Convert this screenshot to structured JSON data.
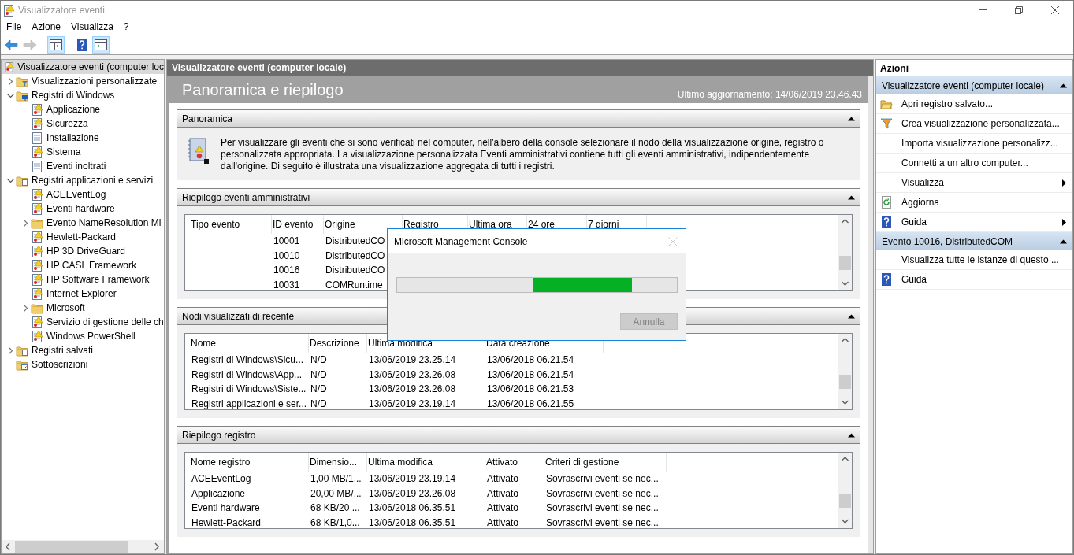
{
  "window": {
    "title": "Visualizzatore eventi"
  },
  "menu": [
    "File",
    "Azione",
    "Visualizza",
    "?"
  ],
  "toolbar": [
    {
      "buttons": [
        {
          "kind": "back",
          "disabled": false,
          "pressed": false
        },
        {
          "kind": "forward",
          "disabled": true,
          "pressed": false
        }
      ]
    },
    {
      "buttons": [
        {
          "kind": "tree-pane",
          "disabled": false,
          "pressed": true
        }
      ]
    },
    {
      "buttons": [
        {
          "kind": "help",
          "disabled": false,
          "pressed": false
        },
        {
          "kind": "action-pane",
          "disabled": false,
          "pressed": true
        }
      ]
    }
  ],
  "tree": [
    {
      "label": "Visualizzatore eventi (computer loc",
      "kind": "viewer",
      "selected": true,
      "children": [
        {
          "label": "Visualizzazioni personalizzate",
          "kind": "filter-folder",
          "selected": false,
          "expandable": true,
          "expanded": false
        },
        {
          "label": "Registri di Windows",
          "kind": "windows-folder",
          "selected": false,
          "expandable": true,
          "expanded": true,
          "children": [
            {
              "label": "Applicazione",
              "kind": "log",
              "selected": false,
              "expandable": false
            },
            {
              "label": "Sicurezza",
              "kind": "log",
              "selected": false,
              "expandable": false
            },
            {
              "label": "Installazione",
              "kind": "plain-log",
              "selected": false,
              "expandable": false
            },
            {
              "label": "Sistema",
              "kind": "log",
              "selected": false,
              "expandable": false
            },
            {
              "label": "Eventi inoltrati",
              "kind": "plain-log",
              "selected": false,
              "expandable": false
            }
          ]
        },
        {
          "label": "Registri applicazioni e servizi",
          "kind": "folder-doc",
          "selected": false,
          "expandable": true,
          "expanded": true,
          "children": [
            {
              "label": "ACEEventLog",
              "kind": "log",
              "selected": false,
              "expandable": false
            },
            {
              "label": "Eventi hardware",
              "kind": "log",
              "selected": false,
              "expandable": false
            },
            {
              "label": "Evento NameResolution Mi",
              "kind": "folder",
              "selected": false,
              "expandable": true,
              "expanded": false
            },
            {
              "label": "Hewlett-Packard",
              "kind": "log",
              "selected": false,
              "expandable": false
            },
            {
              "label": "HP 3D DriveGuard",
              "kind": "log",
              "selected": false,
              "expandable": false
            },
            {
              "label": "HP CASL Framework",
              "kind": "log",
              "selected": false,
              "expandable": false
            },
            {
              "label": "HP Software Framework",
              "kind": "log",
              "selected": false,
              "expandable": false
            },
            {
              "label": "Internet Explorer",
              "kind": "log",
              "selected": false,
              "expandable": false
            },
            {
              "label": "Microsoft",
              "kind": "folder",
              "selected": false,
              "expandable": true,
              "expanded": false
            },
            {
              "label": "Servizio di gestione delle ch",
              "kind": "log",
              "selected": false,
              "expandable": false
            },
            {
              "label": "Windows PowerShell",
              "kind": "log",
              "selected": false,
              "expandable": false
            }
          ]
        },
        {
          "label": "Registri salvati",
          "kind": "folder-doc",
          "selected": false,
          "expandable": true,
          "expanded": false
        },
        {
          "label": "Sottoscrizioni",
          "kind": "subscriptions",
          "selected": false,
          "expandable": false
        }
      ]
    }
  ],
  "center": {
    "header": "Visualizzatore eventi (computer locale)",
    "title": "Panoramica e riepilogo",
    "last_update": "Ultimo aggiornamento: 14/06/2019 23.46.43",
    "sections": [
      {
        "kind": "text",
        "title": "Panoramica",
        "expanded": true,
        "text": "Per visualizzare gli eventi che si sono verificati nel computer, nell'albero della console selezionare il nodo della visualizzazione origine, registro o personalizzata appropriata. La visualizzazione personalizzata Eventi amministrativi contiene tutti gli eventi amministrativi, indipendentemente dall'origine. Di seguito è illustrata una visualizzazione aggregata di tutti i registri."
      },
      {
        "kind": "table",
        "title": "Riepilogo eventi amministrativi",
        "expanded": true,
        "columns": [
          "Tipo evento",
          "ID evento",
          "Origine",
          "Registro",
          "Ultima ora",
          "24 ore",
          "7 giorni"
        ],
        "rows": [
          [
            null,
            "10001",
            "DistributedCO"
          ],
          [
            null,
            "10010",
            "DistributedCO"
          ],
          [
            null,
            "10016",
            "DistributedCO"
          ],
          [
            null,
            "10031",
            "COMRuntime"
          ]
        ]
      },
      {
        "kind": "table",
        "title": "Nodi visualizzati di recente",
        "expanded": true,
        "columns": [
          "Nome",
          "Descrizione",
          "Ultima modifica",
          "Data creazione"
        ],
        "rows": [
          [
            "Registri di Windows\\Sicu...",
            "N/D",
            "13/06/2019 23.25.14",
            "13/06/2018 06.21.54"
          ],
          [
            "Registri di Windows\\App...",
            "N/D",
            "13/06/2019 23.26.08",
            "13/06/2018 06.21.54"
          ],
          [
            "Registri di Windows\\Siste...",
            "N/D",
            "13/06/2019 23.26.08",
            "13/06/2018 06.21.53"
          ],
          [
            "Registri applicazioni e ser...",
            "N/D",
            "13/06/2019 23.19.14",
            "13/06/2018 06.21.55"
          ]
        ]
      },
      {
        "kind": "table",
        "title": "Riepilogo registro",
        "expanded": true,
        "columns": [
          "Nome registro",
          "Dimensio...",
          "Ultima modifica",
          "Attivato",
          "Criteri di gestione"
        ],
        "rows": [
          [
            "ACEEventLog",
            "1,00 MB/1...",
            "13/06/2019 23.19.14",
            "Attivato",
            "Sovrascrivi eventi se nec..."
          ],
          [
            "Applicazione",
            "20,00 MB/...",
            "13/06/2019 23.26.08",
            "Attivato",
            "Sovrascrivi eventi se nec..."
          ],
          [
            "Eventi hardware",
            "68 KB/20 ...",
            "13/06/2018 06.35.51",
            "Attivato",
            "Sovrascrivi eventi se nec..."
          ],
          [
            "Hewlett-Packard",
            "68 KB/1,0...",
            "13/06/2018 06.35.51",
            "Attivato",
            "Sovrascrivi eventi se nec..."
          ]
        ]
      }
    ]
  },
  "actions": {
    "title": "Azioni",
    "groups": [
      {
        "title": "Visualizzatore eventi (computer locale)",
        "expanded": true,
        "items": [
          {
            "label": "Apri registro salvato...",
            "kind": "open-folder",
            "submenu": false
          },
          {
            "label": "Crea visualizzazione personalizzata...",
            "kind": "filter",
            "submenu": false
          },
          {
            "label": "Importa visualizzazione personalizz...",
            "kind": "plain",
            "submenu": false
          },
          {
            "label": "Connetti a un altro computer...",
            "kind": "plain",
            "submenu": false
          },
          {
            "label": "Visualizza",
            "kind": "plain",
            "submenu": true
          },
          {
            "label": "Aggiorna",
            "kind": "refresh",
            "submenu": false
          },
          {
            "label": "Guida",
            "kind": "help",
            "submenu": true
          }
        ]
      },
      {
        "title": "Evento 10016, DistributedCOM",
        "expanded": true,
        "items": [
          {
            "label": "Visualizza tutte le istanze di questo ...",
            "kind": "plain",
            "submenu": false
          },
          {
            "label": "Guida",
            "kind": "help",
            "submenu": false
          }
        ]
      }
    ]
  },
  "dialog": {
    "title": "Microsoft Management Console",
    "button": {
      "label": "Annulla",
      "disabled": true
    }
  }
}
